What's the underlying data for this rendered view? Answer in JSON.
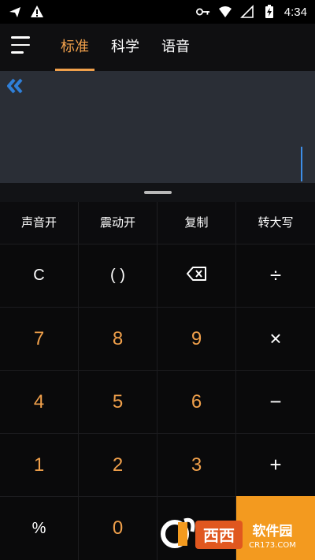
{
  "status_bar": {
    "time": "4:34",
    "icons": [
      "airplane-notify-icon",
      "warning-icon",
      "key-icon",
      "wifi-icon",
      "signal-icon",
      "battery-charging-icon"
    ]
  },
  "app_bar": {
    "menu_icon": "hamburger-menu-icon",
    "tabs": [
      {
        "label": "标准",
        "active": true
      },
      {
        "label": "科学",
        "active": false
      },
      {
        "label": "语音",
        "active": false
      }
    ]
  },
  "display": {
    "expand_icon": "double-chevron-left-icon",
    "input_value": ""
  },
  "options": [
    {
      "label": "声音开"
    },
    {
      "label": "震动开"
    },
    {
      "label": "复制"
    },
    {
      "label": "转大写"
    }
  ],
  "keypad": {
    "row1": [
      {
        "label": "C",
        "kind": "fn"
      },
      {
        "label": "( )",
        "kind": "fn"
      },
      {
        "label": "",
        "kind": "fn",
        "icon": "backspace-icon"
      },
      {
        "label": "÷",
        "kind": "op"
      }
    ],
    "row2": [
      {
        "label": "7",
        "kind": "num"
      },
      {
        "label": "8",
        "kind": "num"
      },
      {
        "label": "9",
        "kind": "num"
      },
      {
        "label": "×",
        "kind": "op"
      }
    ],
    "row3": [
      {
        "label": "4",
        "kind": "num"
      },
      {
        "label": "5",
        "kind": "num"
      },
      {
        "label": "6",
        "kind": "num"
      },
      {
        "label": "−",
        "kind": "op"
      }
    ],
    "row4": [
      {
        "label": "1",
        "kind": "num"
      },
      {
        "label": "2",
        "kind": "num"
      },
      {
        "label": "3",
        "kind": "num"
      },
      {
        "label": "+",
        "kind": "op"
      }
    ],
    "row5": [
      {
        "label": "%",
        "kind": "fn"
      },
      {
        "label": "0",
        "kind": "num"
      },
      {
        "label": "",
        "kind": "num"
      },
      {
        "label": "",
        "kind": "equals"
      }
    ]
  },
  "watermark": {
    "text": "西西软件园",
    "subtext": "CR173.COM"
  },
  "colors": {
    "accent": "#f0a04b",
    "equals_bg": "#f39a1f",
    "display_bg": "#2a2e36",
    "cursor": "#3d8ee8"
  }
}
